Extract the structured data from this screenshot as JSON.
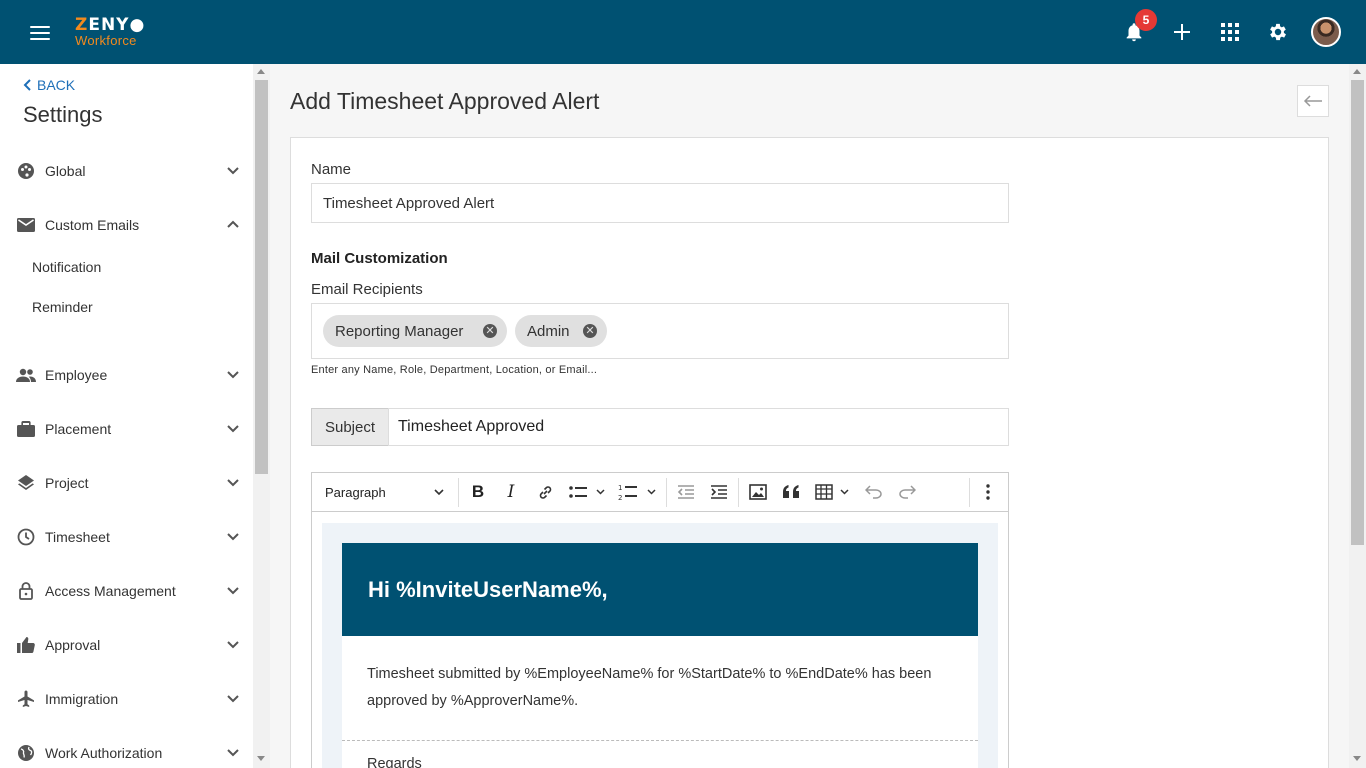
{
  "header": {
    "logo_top": "ZENYO",
    "logo_bottom": "Workforce",
    "notification_count": "5"
  },
  "sidebar": {
    "back_label": "BACK",
    "title": "Settings",
    "items": [
      {
        "label": "Global",
        "icon": "palette-icon"
      },
      {
        "label": "Custom Emails",
        "icon": "email-icon",
        "expanded": true
      },
      {
        "label": "Employee",
        "icon": "people-icon"
      },
      {
        "label": "Placement",
        "icon": "briefcase-icon"
      },
      {
        "label": "Project",
        "icon": "layers-icon"
      },
      {
        "label": "Timesheet",
        "icon": "clock-icon"
      },
      {
        "label": "Access Management",
        "icon": "lock-icon"
      },
      {
        "label": "Approval",
        "icon": "thumbs-up-icon"
      },
      {
        "label": "Immigration",
        "icon": "airplane-icon"
      },
      {
        "label": "Work Authorization",
        "icon": "globe-icon"
      }
    ],
    "sub_items": [
      "Notification",
      "Reminder"
    ]
  },
  "main": {
    "title": "Add Timesheet Approved Alert",
    "form": {
      "name_label": "Name",
      "name_value": "Timesheet Approved Alert",
      "section_title": "Mail Customization",
      "recipients_label": "Email Recipients",
      "recipients": [
        "Reporting Manager",
        "Admin"
      ],
      "recipients_hint": "Enter any Name, Role, Department, Location, or Email...",
      "subject_label": "Subject",
      "subject_value": "Timesheet Approved"
    },
    "editor": {
      "block_format": "Paragraph",
      "greeting": "Hi %InviteUserName%,",
      "body": "Timesheet submitted by %EmployeeName% for %StartDate% to %EndDate% has been approved by %ApproverName%.",
      "closing": "Regards"
    }
  },
  "colors": {
    "primary": "#005172",
    "accent": "#f28a1e",
    "badge": "#e53935"
  }
}
